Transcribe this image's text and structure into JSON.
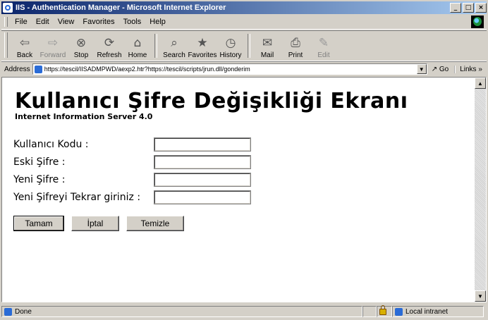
{
  "window": {
    "title": "IIS - Authentication Manager - Microsoft Internet Explorer"
  },
  "menu": [
    "File",
    "Edit",
    "View",
    "Favorites",
    "Tools",
    "Help"
  ],
  "toolbar": [
    {
      "label": "Back",
      "icon": "⇦",
      "disabled": false
    },
    {
      "label": "Forward",
      "icon": "⇨",
      "disabled": true
    },
    {
      "label": "Stop",
      "icon": "⊗",
      "disabled": false
    },
    {
      "label": "Refresh",
      "icon": "⟳",
      "disabled": false
    },
    {
      "label": "Home",
      "icon": "⌂",
      "disabled": false
    },
    {
      "label": "Search",
      "icon": "⌕",
      "disabled": false
    },
    {
      "label": "Favorites",
      "icon": "★",
      "disabled": false
    },
    {
      "label": "History",
      "icon": "◷",
      "disabled": false
    },
    {
      "label": "Mail",
      "icon": "✉",
      "disabled": false
    },
    {
      "label": "Print",
      "icon": "⎙",
      "disabled": false
    },
    {
      "label": "Edit",
      "icon": "✎",
      "disabled": true
    }
  ],
  "address": {
    "label": "Address",
    "url": "https://tescil/IISADMPWD/aexp2.htr?https://tescil/scripts/jrun.dll/gonderim",
    "go": "Go",
    "links": "Links »"
  },
  "page": {
    "heading": "Kullanıcı Şifre Değişikliği Ekranı",
    "subheading": "Internet Information Server 4.0",
    "fields": [
      {
        "label": "Kullanıcı Kodu :",
        "value": ""
      },
      {
        "label": "Eski Şifre :",
        "value": ""
      },
      {
        "label": "Yeni Şifre :",
        "value": ""
      },
      {
        "label": "Yeni Şifreyi Tekrar giriniz :",
        "value": ""
      }
    ],
    "buttons": [
      "Tamam",
      "İptal",
      "Temizle"
    ]
  },
  "status": {
    "text": "Done",
    "zone": "Local intranet"
  }
}
